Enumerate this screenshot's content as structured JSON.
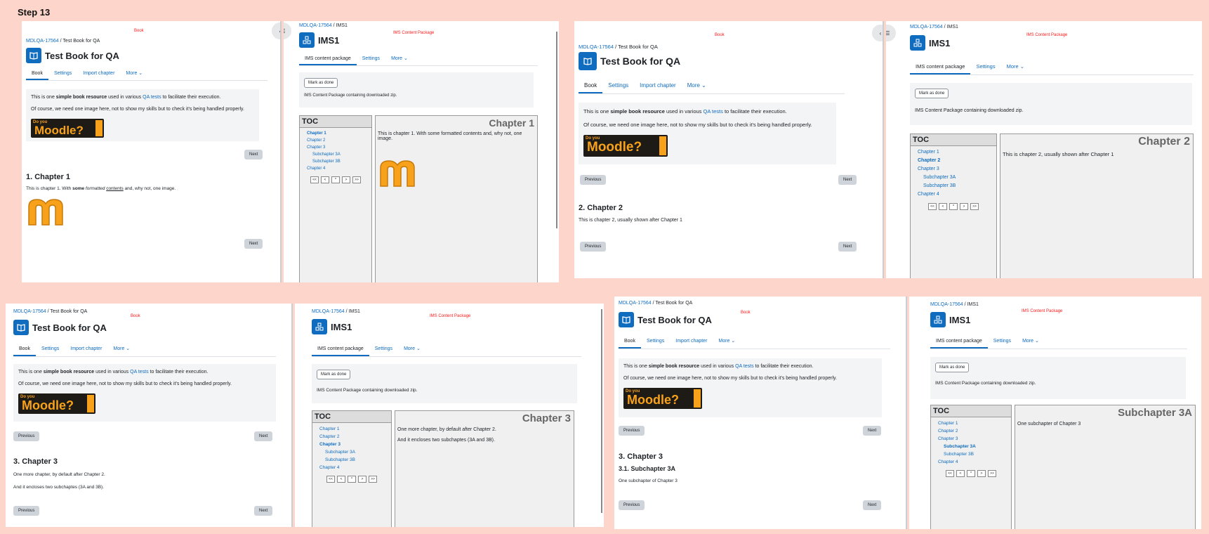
{
  "step": "Step 13",
  "book": {
    "tag": "Book",
    "breadcrumb_course": "MDLQA-17564",
    "breadcrumb_page": "Test Book for QA",
    "title": "Test Book for QA",
    "tabs": [
      "Book",
      "Settings",
      "Import chapter",
      "More ⌄"
    ],
    "intro_pre": "This is one ",
    "intro_bold": "simple book resource",
    "intro_mid": " used in various ",
    "intro_link": "QA tests",
    "intro_post": " to facilitate their execution.",
    "intro2": "Of course, we need one image here, not to show my skills but to check it's being handled properly.",
    "prev": "Previous",
    "next": "Next",
    "logo_do": "Do you",
    "logo_word": "Moodle?",
    "logo_side": "moodle.org"
  },
  "ims": {
    "tag": "IMS Content Package",
    "breadcrumb_course": "MDLQA-17564",
    "breadcrumb_page": "IMS1",
    "title": "IMS1",
    "tabs": [
      "IMS content package",
      "Settings",
      "More ⌄"
    ],
    "mark_done": "Mark as done",
    "description": "IMS Content Package containing downloaded zip.",
    "toc_title": "TOC",
    "toc": [
      "Chapter 1",
      "Chapter 2",
      "Chapter 3",
      "Subchapter 3A",
      "Subchapter 3B",
      "Chapter 4"
    ],
    "nav": [
      "<<",
      "<",
      "^",
      ">",
      ">>"
    ]
  },
  "frames": [
    {
      "book_heading": "1. Chapter 1",
      "book_text_pre": "This is chapter 1. With ",
      "book_text_b": "some",
      "book_text_i": "formatted",
      "book_text_u": "contents",
      "book_text_post": " and, why not, one image.",
      "ims_heading": "Chapter 1",
      "ims_text": "This is chapter 1. With some formatted contents and, why not, one image."
    },
    {
      "book_heading": "2. Chapter 2",
      "book_text": "This is chapter 2, usually shown after Chapter 1",
      "ims_heading": "Chapter 2",
      "ims_text": "This is chapter 2, usually shown after Chapter 1"
    },
    {
      "book_heading": "3. Chapter 3",
      "book_text1": "One more chapter, by default after Chapter 2.",
      "book_text2": "And it encloses two subchaptes (3A and 3B).",
      "ims_heading": "Chapter 3",
      "ims_text1": "One more chapter, by default after Chapter 2.",
      "ims_text2": "And it encloses two subchaptes (3A and 3B)."
    },
    {
      "book_heading": "3. Chapter 3",
      "book_subheading": "3.1. Subchapter 3A",
      "book_text": "One subchapter of Chapter 3",
      "ims_heading": "Subchapter 3A",
      "ims_text": "One subchapter of Chapter 3"
    }
  ]
}
